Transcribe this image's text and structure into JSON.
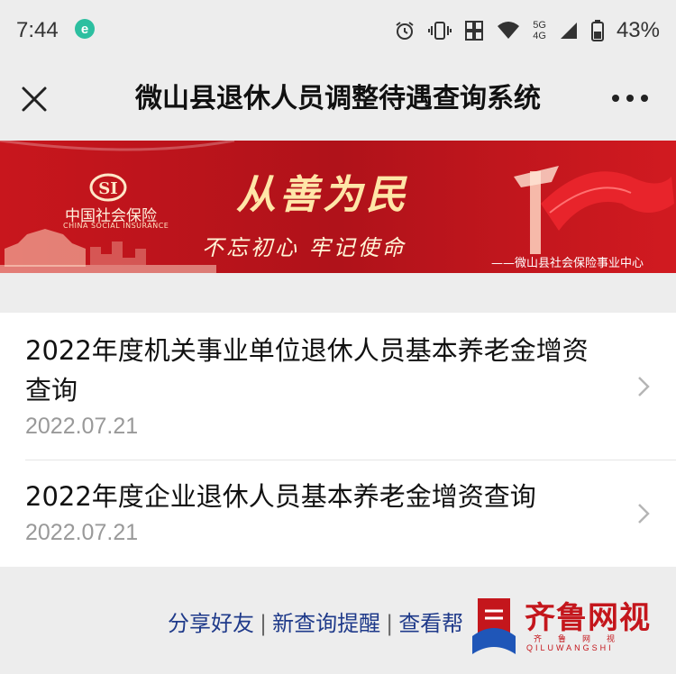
{
  "status_bar": {
    "time": "7:44",
    "network_top": "5G",
    "network_bottom": "4G",
    "battery": "43%"
  },
  "nav": {
    "title": "微山县退休人员调整待遇查询系统"
  },
  "banner": {
    "logo_text": "中国社会保险",
    "logo_sub": "CHINA SOCIAL INSURANCE",
    "slogan_main": "从善为民",
    "slogan_sub": "不忘初心 牢记使命",
    "center": "——微山县社会保险事业中心"
  },
  "items": [
    {
      "title": "2022年度机关事业单位退休人员基本养老金增资查询",
      "date": "2022.07.21"
    },
    {
      "title": "2022年度企业退休人员基本养老金增资查询",
      "date": "2022.07.21"
    }
  ],
  "footer": {
    "share": "分享好友",
    "remind": "新查询提醒",
    "help": "查看帮"
  },
  "watermark": {
    "title": "齐鲁网视",
    "sub_cn": "齐鲁网视",
    "sub_en": "QILUWANGSHI"
  },
  "colors": {
    "accent_red": "#c4161c",
    "link_blue": "#1f3a8a",
    "background": "#ededed"
  }
}
